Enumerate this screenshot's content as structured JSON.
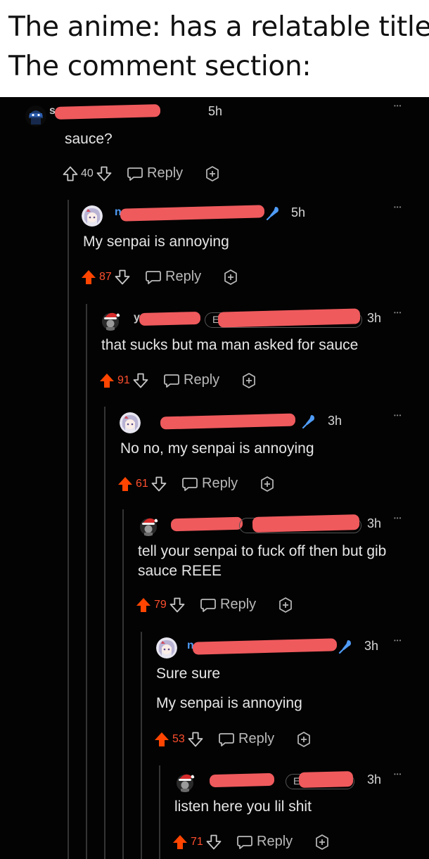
{
  "meme": {
    "line1": "The anime: has a relatable title",
    "line2": "The comment section:"
  },
  "colors": {
    "background": "#030303",
    "upvote_active": "#ff4500",
    "score_active": "#ff4f2e",
    "score_inactive": "#c8c8c8",
    "author_blue": "#4f9cf7",
    "redaction": "#ef5a5d"
  },
  "comments": [
    {
      "author_visible": "s",
      "time": "5h",
      "body": [
        "sauce?"
      ],
      "score": "40",
      "upvoted": false,
      "reply_label": "Reply",
      "more_icon": "dots-icon",
      "avatar": "ninja-avatar"
    },
    {
      "author_visible": "n",
      "time": "5h",
      "body": [
        "My senpai is annoying"
      ],
      "score": "87",
      "upvoted": true,
      "reply_label": "Reply",
      "more_icon": "dots-icon",
      "avatar": "anime-girl-avatar",
      "flair_icon": "microphone-icon"
    },
    {
      "author_visible": "y",
      "flair_visible": "E",
      "time": "3h",
      "body": [
        "that sucks but ma man asked for sauce"
      ],
      "score": "91",
      "upvoted": true,
      "reply_label": "Reply",
      "more_icon": "dots-icon",
      "avatar": "santa-hat-avatar"
    },
    {
      "author_visible": "",
      "time": "3h",
      "body": [
        "No no, my senpai is annoying"
      ],
      "score": "61",
      "upvoted": true,
      "reply_label": "Reply",
      "more_icon": "dots-icon",
      "avatar": "anime-girl-avatar",
      "flair_icon": "microphone-icon"
    },
    {
      "author_visible": "",
      "time": "3h",
      "body": [
        "tell your senpai to fuck off then but gib",
        "sauce REEE"
      ],
      "score": "79",
      "upvoted": true,
      "reply_label": "Reply",
      "more_icon": "dots-icon",
      "avatar": "santa-hat-avatar"
    },
    {
      "author_visible": "n",
      "time": "3h",
      "body": [
        "Sure sure",
        "My senpai is annoying"
      ],
      "score": "53",
      "upvoted": true,
      "reply_label": "Reply",
      "more_icon": "dots-icon",
      "avatar": "anime-girl-avatar",
      "flair_icon": "microphone-icon"
    },
    {
      "author_visible": "",
      "flair_visible": "E",
      "time": "3h",
      "body": [
        "listen here you lil shit"
      ],
      "score": "71",
      "upvoted": true,
      "reply_label": "Reply",
      "more_icon": "dots-icon",
      "avatar": "santa-hat-avatar"
    }
  ]
}
